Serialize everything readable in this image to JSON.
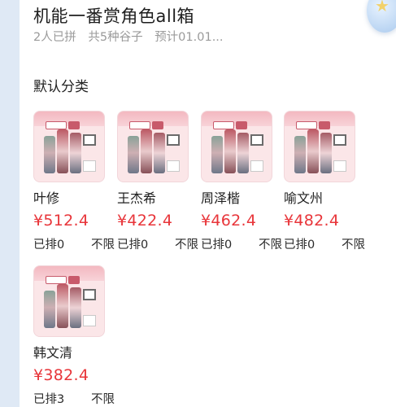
{
  "header": {
    "title": "机能一番赏角色all箱",
    "joined": "2人已拼",
    "variety": "共5种谷子",
    "estimate": "预计01.01..."
  },
  "section": {
    "title": "默认分类"
  },
  "products": [
    {
      "name": "叶修",
      "price": "¥512.4",
      "queued": "已排0",
      "limit": "不限"
    },
    {
      "name": "王杰希",
      "price": "¥422.4",
      "queued": "已排0",
      "limit": "不限"
    },
    {
      "name": "周泽楷",
      "price": "¥462.4",
      "queued": "已排0",
      "limit": "不限"
    },
    {
      "name": "喻文州",
      "price": "¥482.4",
      "queued": "已排0",
      "limit": "不限"
    },
    {
      "name": "韩文清",
      "price": "¥382.4",
      "queued": "已排3",
      "limit": "不限"
    }
  ],
  "colors": {
    "price": "#e8353a",
    "background": "#dfe9f5"
  }
}
